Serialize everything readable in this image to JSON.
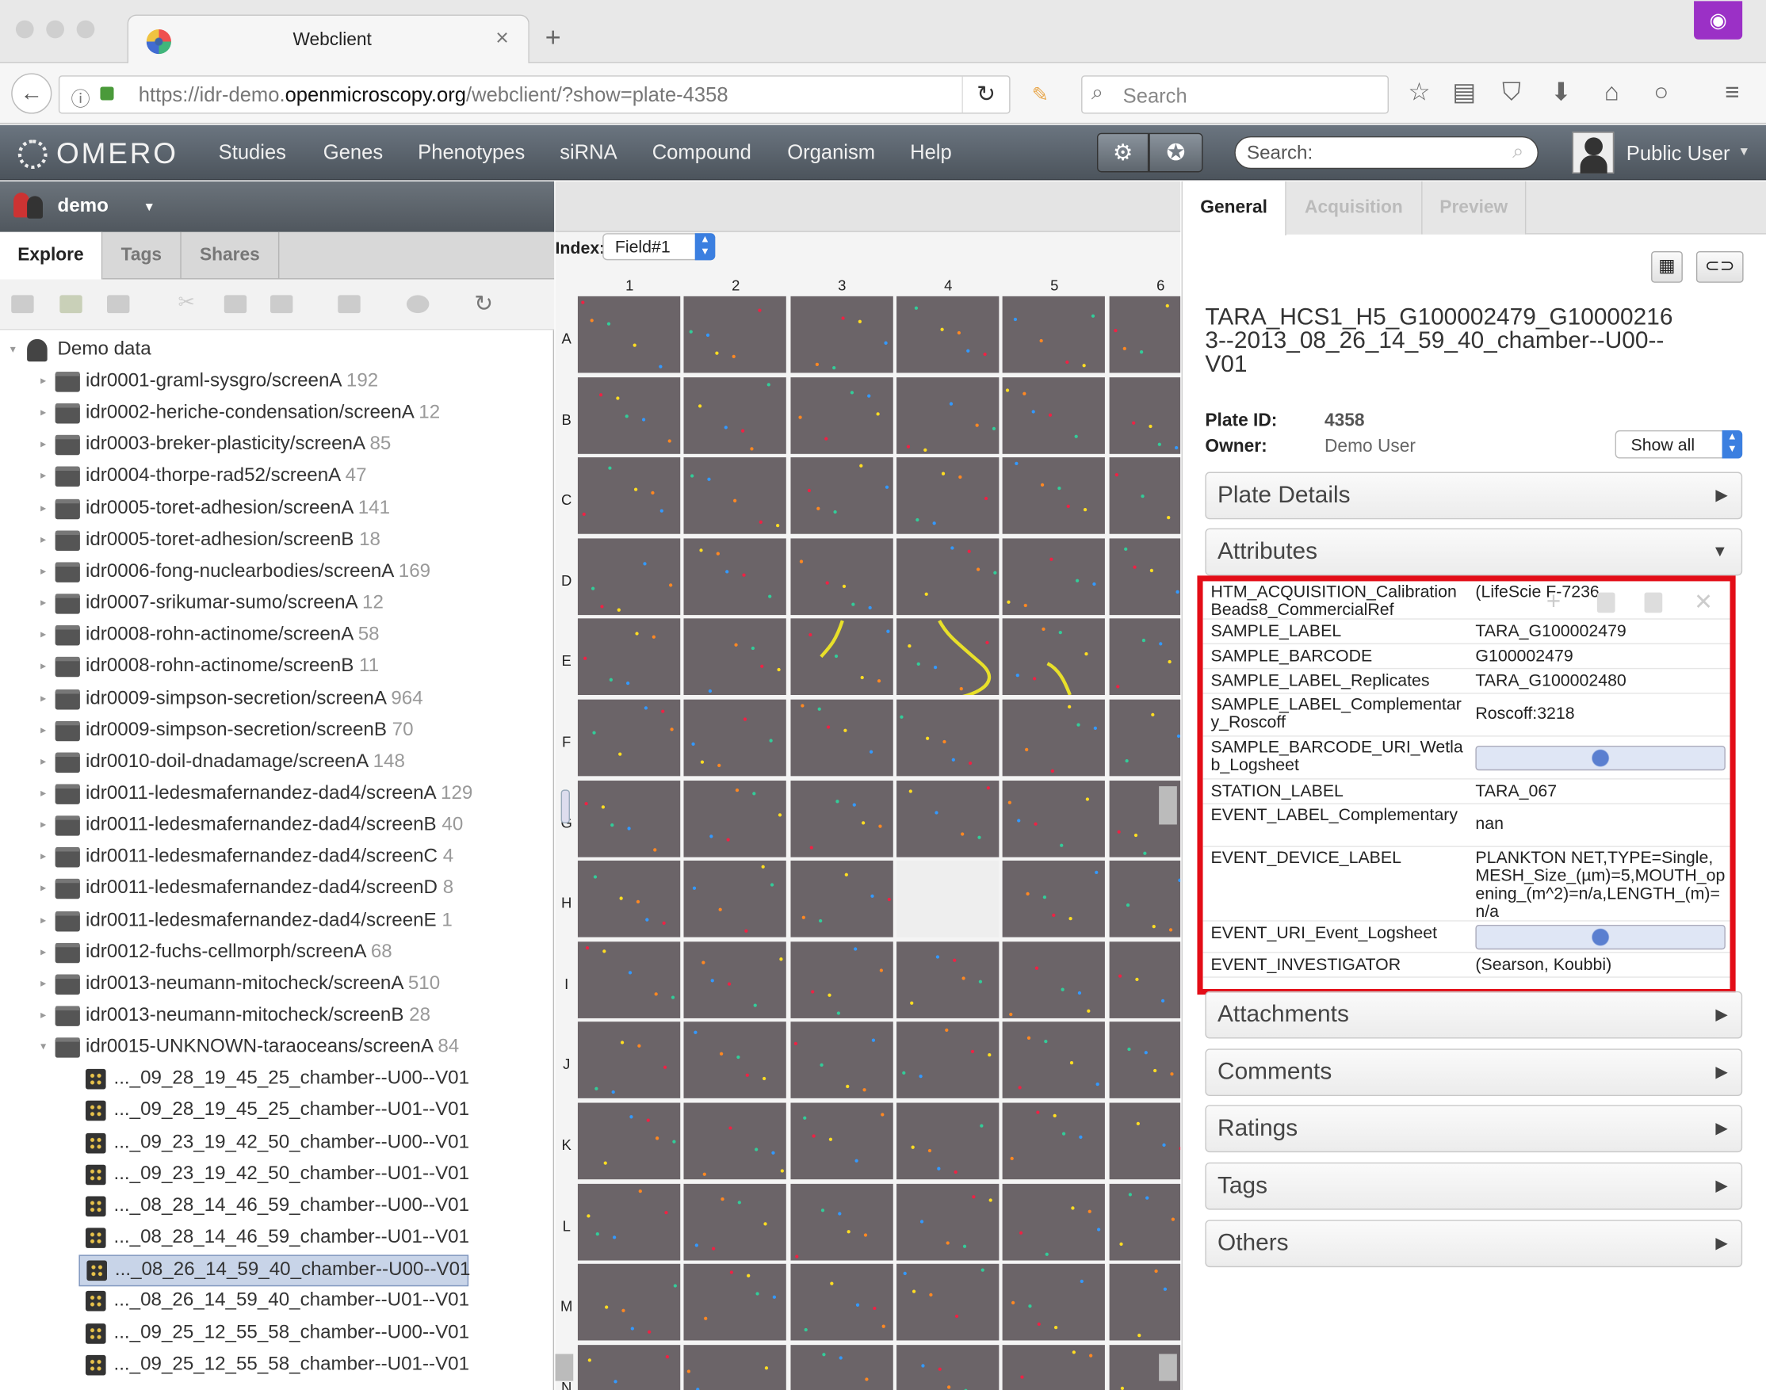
{
  "browser": {
    "tab_title": "Webclient",
    "tab_close": "×",
    "new_tab": "+",
    "url_prefix": "https://idr-demo.",
    "url_domain": "openmicroscopy.org",
    "url_path": "/webclient/?show=plate-4358",
    "search_placeholder": "Search"
  },
  "omero": {
    "logo": "OMERO",
    "nav": [
      "Studies",
      "Genes",
      "Phenotypes",
      "siRNA",
      "Compound",
      "Organism",
      "Help"
    ],
    "search_placeholder": "Search:",
    "user": "Public User"
  },
  "left": {
    "user": "demo",
    "tabs": [
      "Explore",
      "Tags",
      "Shares"
    ],
    "root": "Demo data",
    "screens": [
      {
        "name": "idr0001-graml-sysgro/screenA",
        "count": "192"
      },
      {
        "name": "idr0002-heriche-condensation/screenA",
        "count": "12"
      },
      {
        "name": "idr0003-breker-plasticity/screenA",
        "count": "85"
      },
      {
        "name": "idr0004-thorpe-rad52/screenA",
        "count": "47"
      },
      {
        "name": "idr0005-toret-adhesion/screenA",
        "count": "141"
      },
      {
        "name": "idr0005-toret-adhesion/screenB",
        "count": "18"
      },
      {
        "name": "idr0006-fong-nuclearbodies/screenA",
        "count": "169"
      },
      {
        "name": "idr0007-srikumar-sumo/screenA",
        "count": "12"
      },
      {
        "name": "idr0008-rohn-actinome/screenA",
        "count": "58"
      },
      {
        "name": "idr0008-rohn-actinome/screenB",
        "count": "11"
      },
      {
        "name": "idr0009-simpson-secretion/screenA",
        "count": "964"
      },
      {
        "name": "idr0009-simpson-secretion/screenB",
        "count": "70"
      },
      {
        "name": "idr0010-doil-dnadamage/screenA",
        "count": "148"
      },
      {
        "name": "idr0011-ledesmafernandez-dad4/screenA",
        "count": "129"
      },
      {
        "name": "idr0011-ledesmafernandez-dad4/screenB",
        "count": "40"
      },
      {
        "name": "idr0011-ledesmafernandez-dad4/screenC",
        "count": "4"
      },
      {
        "name": "idr0011-ledesmafernandez-dad4/screenD",
        "count": "8"
      },
      {
        "name": "idr0011-ledesmafernandez-dad4/screenE",
        "count": "1"
      },
      {
        "name": "idr0012-fuchs-cellmorph/screenA",
        "count": "68"
      },
      {
        "name": "idr0013-neumann-mitocheck/screenA",
        "count": "510"
      },
      {
        "name": "idr0013-neumann-mitocheck/screenB",
        "count": "28"
      },
      {
        "name": "idr0015-UNKNOWN-taraoceans/screenA",
        "count": "84"
      }
    ],
    "plates": [
      "..._09_28_19_45_25_chamber--U00--V01",
      "..._09_28_19_45_25_chamber--U01--V01",
      "..._09_23_19_42_50_chamber--U00--V01",
      "..._09_23_19_42_50_chamber--U01--V01",
      "..._08_28_14_46_59_chamber--U00--V01",
      "..._08_28_14_46_59_chamber--U01--V01",
      "..._08_26_14_59_40_chamber--U00--V01",
      "..._08_26_14_59_40_chamber--U01--V01",
      "..._09_25_12_55_58_chamber--U00--V01",
      "..._09_25_12_55_58_chamber--U01--V01"
    ],
    "selected_plate_index": 6
  },
  "center": {
    "index_label": "Index:",
    "field_value": "Field#1",
    "columns": [
      "1",
      "2",
      "3",
      "4",
      "5",
      "6"
    ],
    "rows": [
      "A",
      "B",
      "C",
      "D",
      "E",
      "F",
      "G",
      "H",
      "I",
      "J",
      "K",
      "L",
      "M",
      "N"
    ]
  },
  "right": {
    "tabs": [
      "General",
      "Acquisition",
      "Preview"
    ],
    "title": "TARA_HCS1_H5_G100002479_G100002163--2013_08_26_14_59_40_chamber--U00--V01",
    "plate_id_label": "Plate ID:",
    "plate_id": "4358",
    "owner_label": "Owner:",
    "owner": "Demo User",
    "show_all": "Show all",
    "sections_top": [
      "Plate Details",
      "Attributes"
    ],
    "sections_bottom": [
      "Attachments",
      "Comments",
      "Ratings",
      "Tags",
      "Others"
    ],
    "attributes": [
      {
        "key": "HTM_ACQUISITION_CalibrationBeads8_CommercialRef",
        "value": "(LifeScie F-7236,"
      },
      {
        "key": "SAMPLE_LABEL",
        "value": "TARA_G100002479"
      },
      {
        "key": "SAMPLE_BARCODE",
        "value": "G100002479"
      },
      {
        "key": "SAMPLE_LABEL_Replicates",
        "value": "TARA_G100002480"
      },
      {
        "key": "SAMPLE_LABEL_Complementary_Roscoff",
        "value": "Roscoff:3218"
      },
      {
        "key": "SAMPLE_BARCODE_URI_Wetlab_Logsheet",
        "value": ""
      },
      {
        "key": "STATION_LABEL",
        "value": "TARA_067"
      },
      {
        "key": "EVENT_LABEL_Complementary",
        "value": "nan"
      },
      {
        "key": "EVENT_DEVICE_LABEL",
        "value": "PLANKTON NET,TYPE=Single,MESH_Size_(µm)=5,MOUTH_opening_(m^2)=n/a,LENGTH_(m)=n/a"
      },
      {
        "key": "EVENT_URI_Event_Logsheet",
        "value": ""
      },
      {
        "key": "EVENT_INVESTIGATOR",
        "value": "(Searson, Koubbi)"
      }
    ]
  },
  "colors": {
    "highlight_border": "#e30d17",
    "well": "#6b6468",
    "selected_row": "#c8d4e8"
  }
}
